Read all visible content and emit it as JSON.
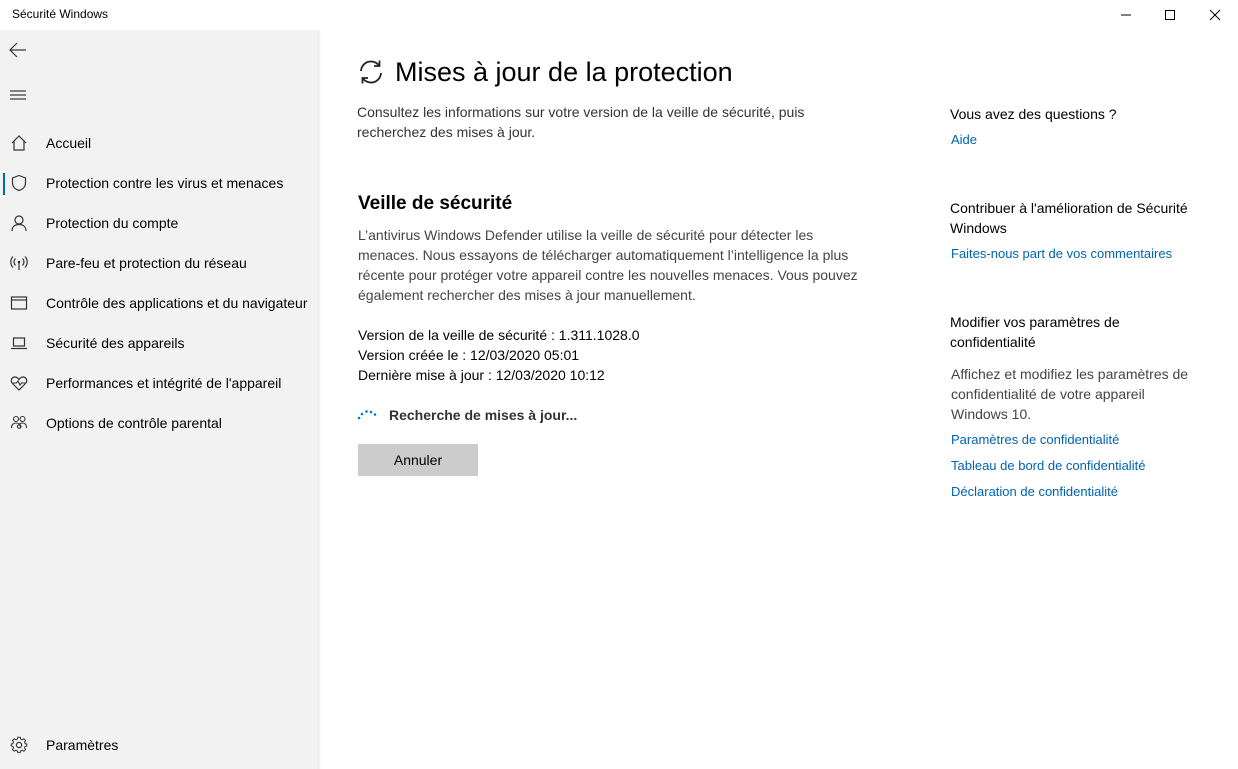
{
  "window": {
    "title": "Sécurité Windows",
    "minimize_icon": "minimize-icon",
    "maximize_icon": "maximize-icon",
    "close_icon": "close-icon"
  },
  "sidebar": {
    "back_icon": "back-arrow-icon",
    "menu_icon": "hamburger-menu-icon",
    "items": [
      {
        "label": "Accueil",
        "icon": "home-icon"
      },
      {
        "label": "Protection contre les virus et menaces",
        "icon": "shield-icon",
        "active": true
      },
      {
        "label": "Protection du compte",
        "icon": "person-icon"
      },
      {
        "label": "Pare-feu et protection du réseau",
        "icon": "wifi-antenna-icon"
      },
      {
        "label": "Contrôle des applications et du navigateur",
        "icon": "browser-window-icon"
      },
      {
        "label": "Sécurité des appareils",
        "icon": "laptop-icon"
      },
      {
        "label": "Performances et intégrité de l'appareil",
        "icon": "heart-pulse-icon"
      },
      {
        "label": "Options de contrôle parental",
        "icon": "family-icon"
      }
    ],
    "settings": {
      "label": "Paramètres",
      "icon": "gear-icon"
    }
  },
  "main": {
    "title": "Mises à jour de la protection",
    "title_icon": "refresh-icon",
    "intro": "Consultez les informations sur votre version de la veille de sécurité, puis recherchez des mises à jour.",
    "section_title": "Veille de sécurité",
    "section_desc": "L’antivirus Windows Defender utilise la veille de sécurité pour détecter les menaces. Nous essayons de télécharger automatiquement l’intelligence la plus récente pour protéger votre appareil contre les nouvelles menaces. Vous pouvez également rechercher des mises à jour manuellement.",
    "version_line": "Version de la veille de sécurité : 1.311.1028.0",
    "created_line": "Version créée le : 12/03/2020 05:01",
    "updated_line": "Dernière mise à jour : 12/03/2020 10:12",
    "status_text": "Recherche de mises à jour...",
    "status_icon": "loading-spinner-icon",
    "cancel_label": "Annuler"
  },
  "aside": {
    "questions_head": "Vous avez des questions ?",
    "help_link": "Aide",
    "contribute_head": "Contribuer à l'amélioration de Sécurité Windows",
    "feedback_link": "Faites-nous part de vos commentaires",
    "privacy_head": "Modifier vos paramètres de confidentialité",
    "privacy_text": "Affichez et modifiez les paramètres de confidentialité de votre appareil Windows 10.",
    "privacy_links": [
      "Paramètres de confidentialité",
      "Tableau de bord de confidentialité",
      "Déclaration de confidentialité"
    ]
  },
  "colors": {
    "accent": "#0067c0",
    "link": "#0063b1",
    "sidebar_bg": "#f2f2f2",
    "button_bg": "#cccccc"
  }
}
